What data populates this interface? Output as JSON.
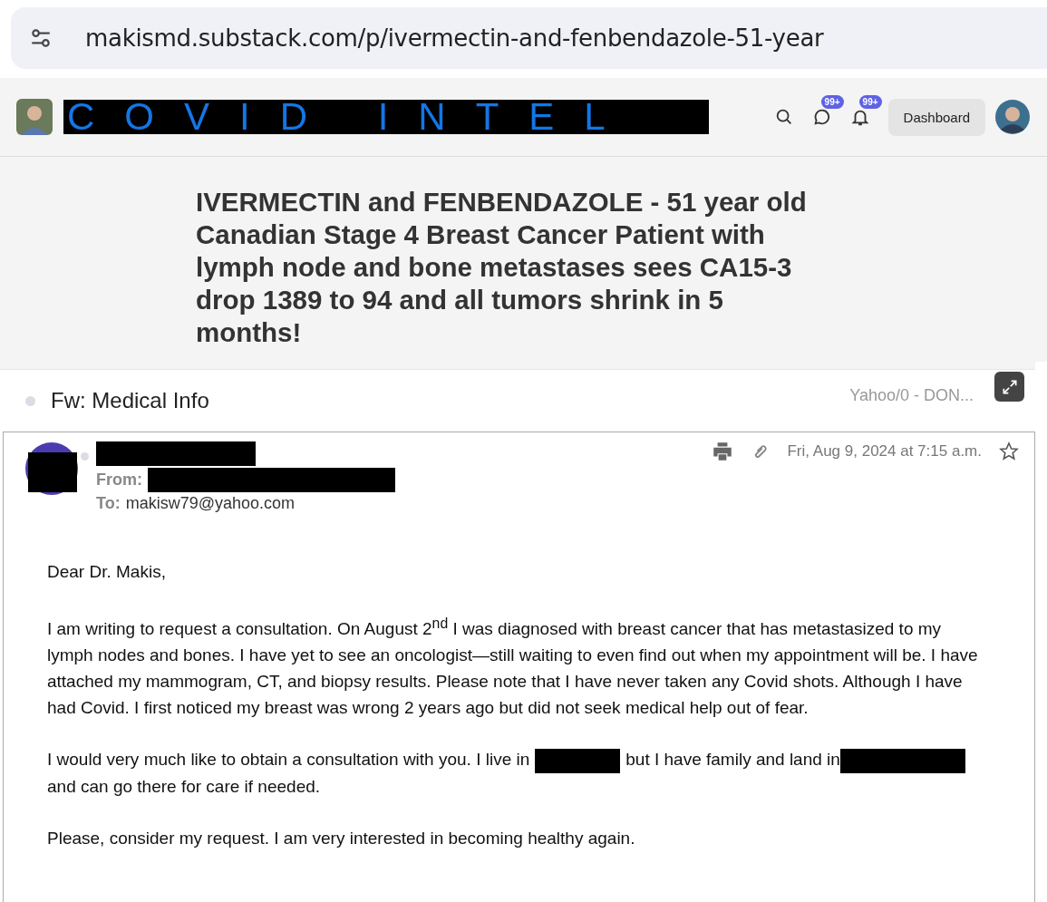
{
  "address_bar": {
    "url": "makismd.substack.com/p/ivermectin-and-fenbendazole-51-year"
  },
  "header": {
    "logo_text": "COVID INTEL",
    "chat_badge": "99+",
    "bell_badge": "99+",
    "dashboard": "Dashboard"
  },
  "post_title": "IVERMECTIN and FENBENDAZOLE - 51 year old Canadian Stage 4 Breast Cancer Patient with lymph node and bone metastases sees CA15-3 drop 1389 to 94 and all tumors shrink in 5 months!",
  "email": {
    "subject": "Fw: Medical Info",
    "folder": "Yahoo/0 - DON...",
    "from_label": "From:",
    "to_label": "To:",
    "to": "makisw79@yahoo.com",
    "date": "Fri, Aug 9, 2024 at 7:15 a.m.",
    "paragraphs": [
      [
        {
          "kind": "text",
          "text": "Dear Dr. Makis,"
        }
      ],
      [
        {
          "kind": "text",
          "text": "I am writing to request a consultation.  On August 2$^{nd}$ I was diagnosed with breast cancer that has metastasized to my lymph nodes and bones.  I have yet to see an oncologist—still waiting to even find out when my appointment will be.  I have attached my mammogram, CT, and biopsy results.  Please note that I have never taken any Covid shots.  Although I have had Covid.  I first noticed my breast was wrong 2 years ago but did not seek medical help out of fear."
        }
      ],
      [
        {
          "kind": "text",
          "text": "I would very much like to obtain a consultation with you.  I live in"
        },
        {
          "kind": "redacted"
        },
        {
          "kind": "text",
          "text": "but I have family and land in"
        },
        {
          "kind": "redacted"
        },
        {
          "kind": "text",
          "text": "and can go there for care if needed."
        }
      ],
      [
        {
          "kind": "text",
          "text": "Please, consider my request.  I am very interested in becoming healthy again."
        }
      ]
    ]
  }
}
